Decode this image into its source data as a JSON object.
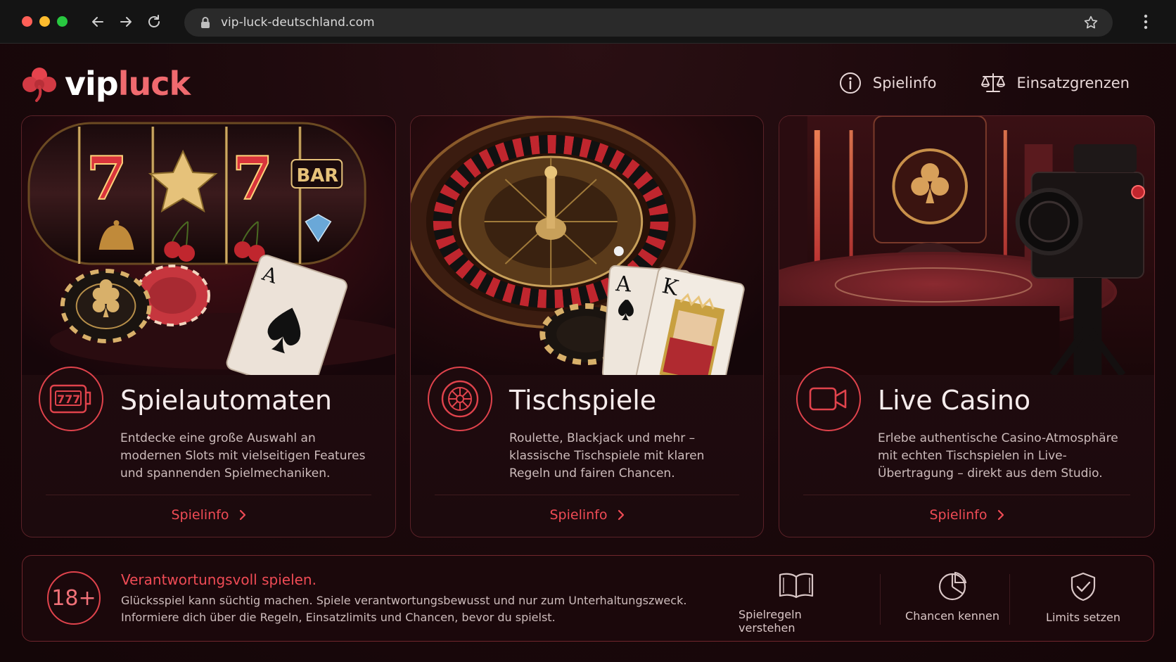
{
  "browser": {
    "url": "vip-luck-deutschland.com"
  },
  "brand": {
    "name_part1": "vip",
    "name_part2": "luck",
    "accent": "#ef4b55"
  },
  "topnav": {
    "items": [
      {
        "label": "Spielinfo",
        "icon": "info-icon"
      },
      {
        "label": "Einsatzgrenzen",
        "icon": "scale-icon"
      }
    ]
  },
  "cards": [
    {
      "title": "Spielautomaten",
      "description": "Entdecke eine große Auswahl an modernen Slots mit vielseitigen Features und spannenden Spielmechaniken.",
      "link": "Spielinfo",
      "icon": "slot-machine-icon"
    },
    {
      "title": "Tischspiele",
      "description": "Roulette, Blackjack und mehr – klassische Tischspiele mit klaren Regeln und fairen Chancen.",
      "link": "Spielinfo",
      "icon": "roulette-icon"
    },
    {
      "title": "Live Casino",
      "description": "Erlebe authentische Casino-Atmosphäre mit echten Tischspielen in Live-Übertragung – direkt aus dem Studio.",
      "link": "Spielinfo",
      "icon": "video-camera-icon"
    }
  ],
  "card_art": {
    "slot_reel_symbols": [
      "7",
      "7",
      "BAR"
    ],
    "card_rank_ace": "A",
    "card_rank_king": "K"
  },
  "responsible": {
    "age_badge": "18+",
    "title": "Verantwortungsvoll spielen.",
    "text": "Glücksspiel kann süchtig machen. Spiele verantwortungsbewusst und nur zum Unterhaltungszweck. Informiere dich über die Regeln, Einsatzlimits und Chancen, bevor du spielst.",
    "features": [
      {
        "label": "Spielregeln verstehen",
        "icon": "book-icon"
      },
      {
        "label": "Chancen kennen",
        "icon": "pie-chart-icon"
      },
      {
        "label": "Limits setzen",
        "icon": "shield-check-icon"
      }
    ]
  }
}
